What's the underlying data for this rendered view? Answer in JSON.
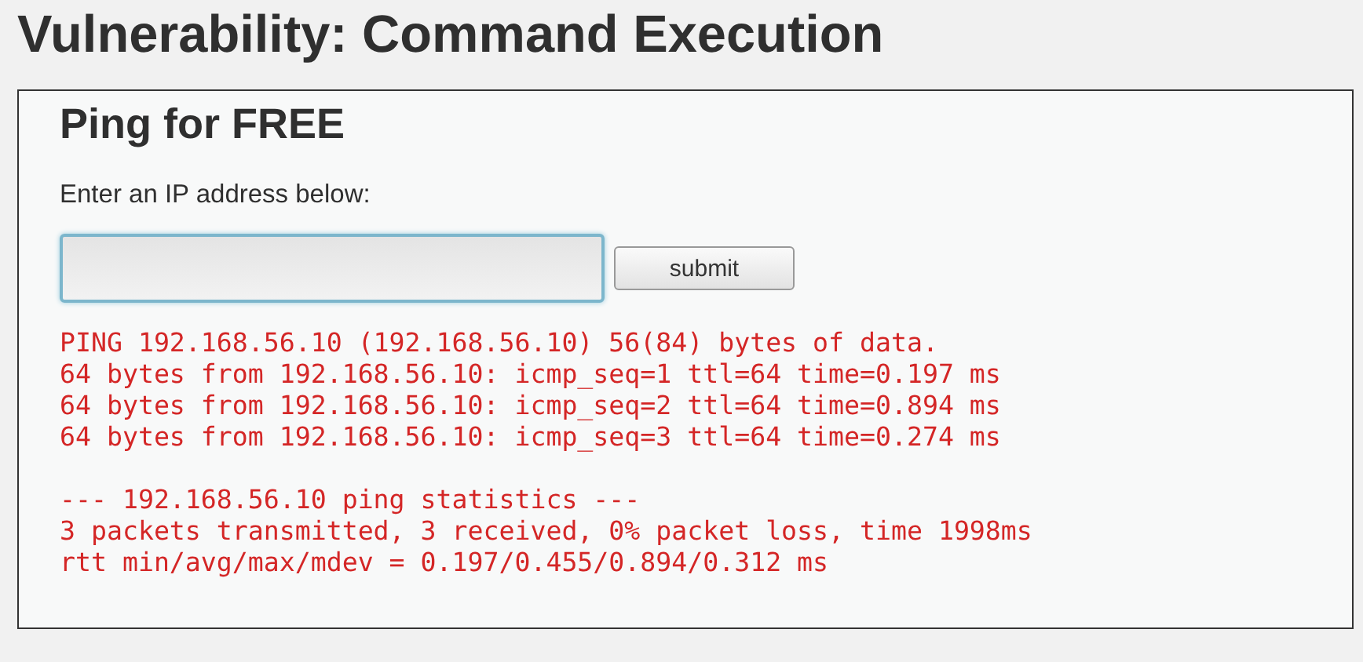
{
  "page_title": "Vulnerability: Command Execution",
  "form": {
    "heading": "Ping for FREE",
    "label": "Enter an IP address below:",
    "ip_field": {
      "focused": true
    },
    "submit_button": "submit"
  },
  "output": {
    "blocks": [
      [
        "PING 192.168.56.10 (192.168.56.10) 56(84) bytes of data.",
        "64 bytes from 192.168.56.10: icmp_seq=1 ttl=64 time=0.197 ms",
        "64 bytes from 192.168.56.10: icmp_seq=2 ttl=64 time=0.894 ms",
        "64 bytes from 192.168.56.10: icmp_seq=3 ttl=64 time=0.274 ms"
      ],
      [
        "--- 192.168.56.10 ping statistics ---",
        "3 packets transmitted, 3 received, 0% packet loss, time 1998ms",
        "rtt min/avg/max/mdev = 0.197/0.455/0.894/0.312 ms"
      ]
    ]
  }
}
